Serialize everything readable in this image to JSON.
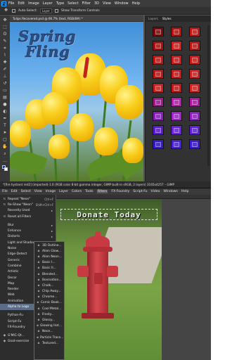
{
  "photoshop": {
    "logo": "Ps",
    "menu": [
      "File",
      "Edit",
      "Image",
      "Layer",
      "Type",
      "Select",
      "Filter",
      "3D",
      "View",
      "Window",
      "Help"
    ],
    "options": {
      "auto_select": "Auto-Select:",
      "layer_select": "Layer",
      "transform": "Show Transform Controls"
    },
    "doc_tab": "Tulips Recovered.psd @ 66.7% (text, RGB/8#) *",
    "canvas_title_line1": "Spring",
    "canvas_title_line2": "Fling",
    "panel_tabs": [
      "Layers",
      "Styles"
    ],
    "active_panel_tab": "Styles",
    "styles_colors": [
      "#7a0a0a",
      "#b31212",
      "#c21818",
      "#a81010",
      "#d02020",
      "#b81818",
      "#c01515",
      "#c81c1c",
      "#cc1a1a",
      "#bb1515",
      "#c51a1a",
      "#cc2020",
      "#d01e1e",
      "#c41818",
      "#d22020",
      "#9a1a8a",
      "#b020a8",
      "#a818a0",
      "#8a1abf",
      "#9f24c9",
      "#8f1fc2",
      "#5a1ad0",
      "#6a22e0",
      "#6020d8",
      "#3a18c8",
      "#4a20d6",
      "#3c1ad0"
    ]
  },
  "gimp": {
    "title": "*[fire hydrant red2] (imported)-1.0 (RGB color 8-bit gamma integer, GIMP built-in sRGB, 2 layers) 3165x4257 – GIMP",
    "menu": [
      "File",
      "Edit",
      "Select",
      "View",
      "Image",
      "Layer",
      "Colors",
      "Tools",
      "Filters",
      "FX-Foundry",
      "Script-Fu",
      "Video",
      "Windows",
      "Help"
    ],
    "active_menu": "Filters",
    "banner_text": "Donate Today",
    "filters_menu": [
      {
        "label": "Repeat \"Neon\"",
        "shortcut": "Ctrl+F",
        "icon": "↻"
      },
      {
        "label": "Re-Show \"Neon\"",
        "shortcut": "Shift+Ctrl+F",
        "icon": "↻"
      },
      {
        "label": "Recently Used",
        "arrow": "▸"
      },
      {
        "label": "Reset all Filters",
        "icon": "⟲"
      },
      {
        "label": "Blur",
        "arrow": "▸"
      },
      {
        "label": "Enhance",
        "arrow": "▸"
      },
      {
        "label": "Distorts",
        "arrow": "▸"
      },
      {
        "label": "Light and Shadow",
        "arrow": "▸"
      },
      {
        "label": "Noise",
        "arrow": "▸"
      },
      {
        "label": "Edge-Detect",
        "arrow": "▸"
      },
      {
        "label": "Generic",
        "arrow": "▸"
      },
      {
        "label": "Combine",
        "arrow": "▸"
      },
      {
        "label": "Artistic",
        "arrow": "▸"
      },
      {
        "label": "Decor",
        "arrow": "▸"
      },
      {
        "label": "Map",
        "arrow": "▸"
      },
      {
        "label": "Render",
        "arrow": "▸"
      },
      {
        "label": "Web",
        "arrow": "▸"
      },
      {
        "label": "Animation",
        "arrow": "▸"
      },
      {
        "label": "Alpha to Logo",
        "arrow": "▸",
        "selected": true
      },
      {
        "label": "Python-Fu",
        "arrow": "▸"
      },
      {
        "label": "Script-Fu",
        "arrow": "▸"
      },
      {
        "label": "FX-Foundry",
        "arrow": "▸"
      },
      {
        "label": "G'MIC-Qt...",
        "icon": "◆"
      },
      {
        "label": "Goat-exercise",
        "icon": "◆"
      }
    ],
    "alpha_to_logo_menu": [
      "3D Outline...",
      "Alien Glow...",
      "Alien Neon...",
      "Basic I...",
      "Basic II...",
      "Blended...",
      "Bovination...",
      "Chalk...",
      "Chip Away...",
      "Chrome...",
      "Comic Book...",
      "Cool Metal...",
      "Frosty...",
      "Glossy...",
      "Glowing Hot...",
      "Neon...",
      "Particle Trace...",
      "Textured..."
    ]
  }
}
